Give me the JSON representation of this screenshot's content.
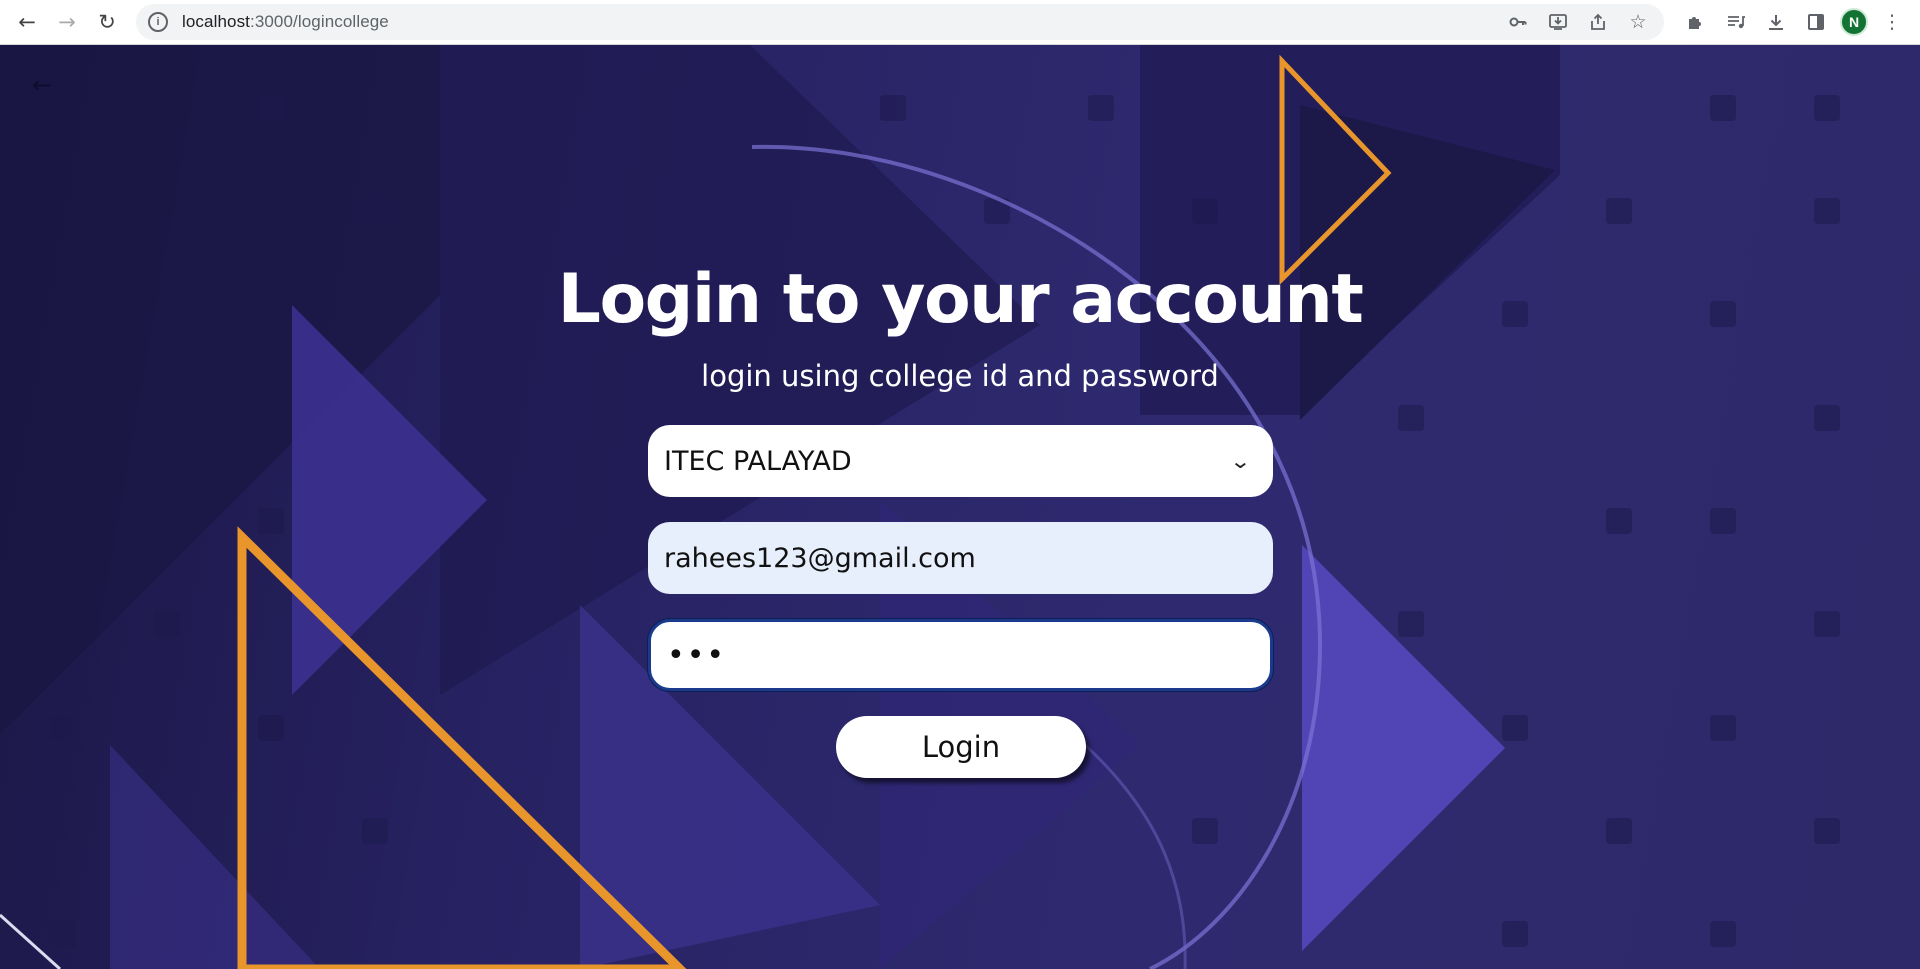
{
  "browser": {
    "url_host": "localhost",
    "url_path": ":3000/logincollege",
    "profile_initial": "N",
    "icons": [
      "back-arrow-icon",
      "forward-arrow-icon",
      "reload-icon",
      "site-info-icon",
      "key-icon",
      "install-icon",
      "share-icon",
      "star-icon",
      "extensions-icon",
      "media-icon",
      "download-icon",
      "side-panel-icon",
      "more-icon"
    ]
  },
  "page": {
    "title": "Login to your account",
    "subtitle": "login using college id and password",
    "college_select": {
      "selected": "ITEC PALAYAD"
    },
    "email": {
      "value": "rahees123@gmail.com"
    },
    "password": {
      "masked": "•••"
    },
    "login_label": "Login"
  },
  "colors": {
    "background": "#2a2566",
    "accent_orange": "#e8962c",
    "field_focus": "#1b3a8c"
  }
}
